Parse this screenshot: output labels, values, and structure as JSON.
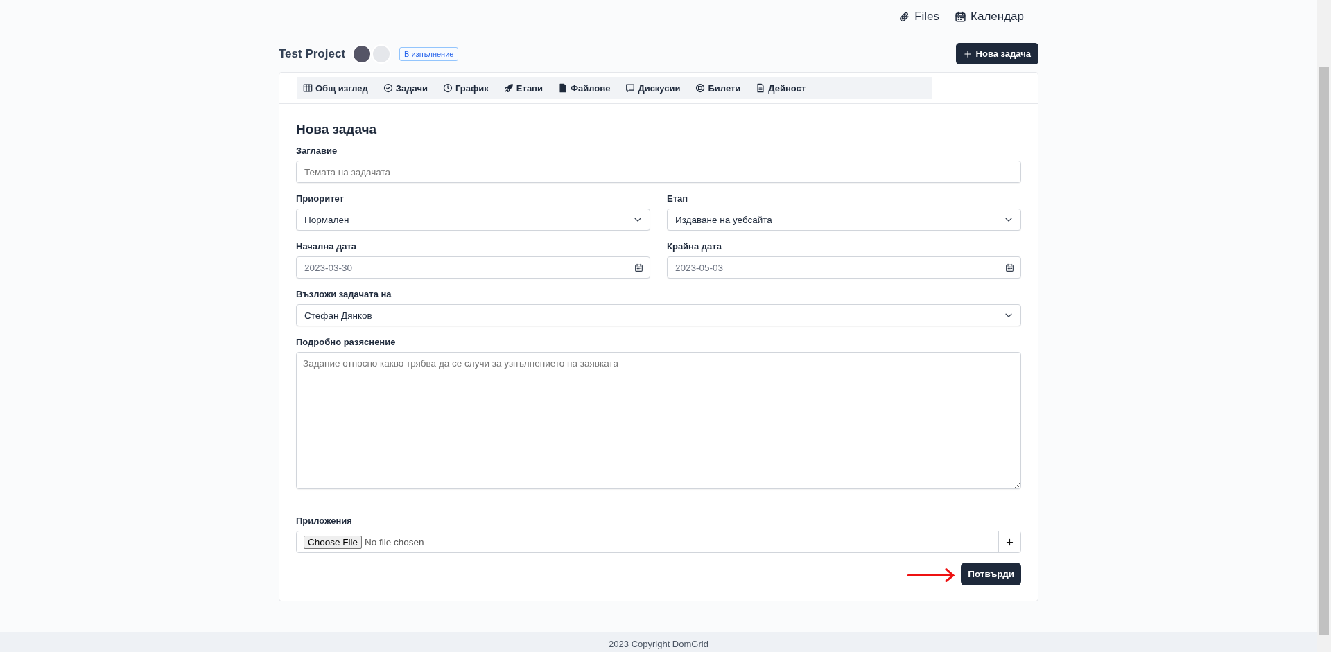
{
  "top_links": [
    {
      "label": "Files"
    },
    {
      "label": "Календар"
    }
  ],
  "project": {
    "name": "Test Project",
    "status": "В изпълнение",
    "new_task_button": "Нова задача"
  },
  "tabs": [
    {
      "label": "Общ изглед"
    },
    {
      "label": "Задачи"
    },
    {
      "label": "График"
    },
    {
      "label": "Етапи"
    },
    {
      "label": "Файлове"
    },
    {
      "label": "Дискусии"
    },
    {
      "label": "Билети"
    },
    {
      "label": "Дейност"
    }
  ],
  "form": {
    "title": "Нова задача",
    "rows": [
      [
        {
          "kind": "text",
          "label": "Заглавие",
          "placeholder": "Темата на задачата"
        }
      ],
      [
        {
          "kind": "select",
          "label": "Приоритет",
          "value": "Нормален"
        },
        {
          "kind": "select",
          "label": "Етап",
          "value": "Издаване на уебсайта"
        }
      ],
      [
        {
          "kind": "date",
          "label": "Начална дата",
          "value": "2023-03-30"
        },
        {
          "kind": "date",
          "label": "Крайна дата",
          "value": "2023-05-03"
        }
      ],
      [
        {
          "kind": "select",
          "label": "Възложи задачата на",
          "value": "Стефан Дянков"
        }
      ],
      [
        {
          "kind": "textarea",
          "label": "Подробно разяснение",
          "placeholder": "Задание относно какво трябва да се случи за узпълнението на заявката"
        }
      ]
    ],
    "attachments": {
      "label": "Приложения",
      "choose_button": "Choose File",
      "status": "No file chosen"
    },
    "submit_button": "Потвърди"
  },
  "footer": "2023 Copyright DomGrid"
}
